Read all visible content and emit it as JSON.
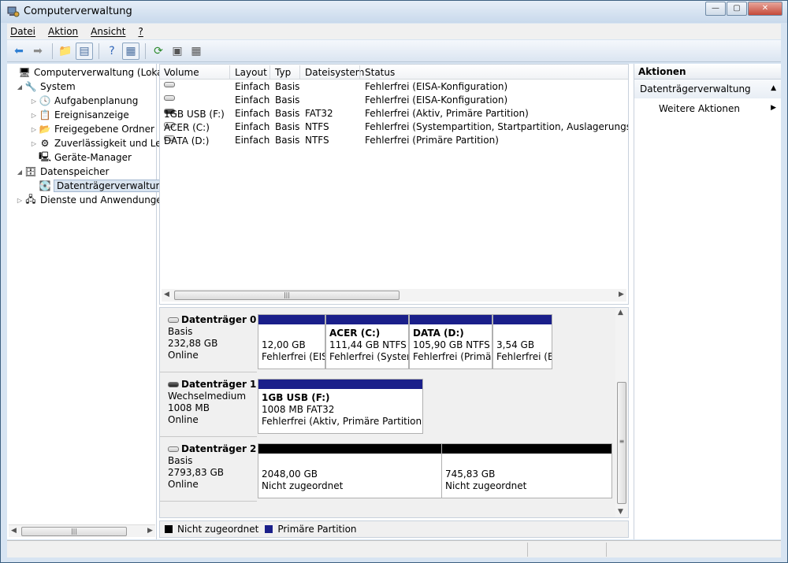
{
  "window": {
    "title": "Computerverwaltung",
    "buttons": {
      "minimize": "—",
      "maximize": "▢",
      "close": "✕"
    }
  },
  "menu": [
    {
      "label": "Datei"
    },
    {
      "label": "Aktion"
    },
    {
      "label": "Ansicht"
    },
    {
      "label": "?"
    }
  ],
  "toolbar": [
    {
      "icon": "back-arrow-icon",
      "glyph": "⬅",
      "color": "#2f7fd3"
    },
    {
      "icon": "forward-arrow-icon",
      "glyph": "➡",
      "color": "#8c8c8c"
    },
    {
      "icon": "up-folder-icon",
      "glyph": "📁",
      "color": "#c89b2d"
    },
    {
      "icon": "show-hide-console-tree-icon",
      "glyph": "▤",
      "color": "#4a6fa0"
    },
    {
      "icon": "help-icon",
      "glyph": "?",
      "color": "#2e64b8"
    },
    {
      "icon": "show-hide-action-pane-icon",
      "glyph": "▦",
      "color": "#4a6fa0"
    },
    {
      "icon": "refresh-icon",
      "glyph": "⟳",
      "color": "#2b8a2b"
    },
    {
      "icon": "properties-icon",
      "glyph": "▣",
      "color": "#555555"
    },
    {
      "icon": "export-list-icon",
      "glyph": "▦",
      "color": "#555555"
    }
  ],
  "tree": [
    {
      "label": "Computerverwaltung (Lokal)",
      "icon": "computer-management-icon",
      "glyph": "🖥",
      "indent": 0,
      "arrow": ""
    },
    {
      "label": "System",
      "icon": "system-tools-icon",
      "glyph": "🔧",
      "indent": 1,
      "arrow": "◢"
    },
    {
      "label": "Aufgabenplanung",
      "icon": "clock-icon",
      "glyph": "🕓",
      "indent": 2,
      "arrow": "▷"
    },
    {
      "label": "Ereignisanzeige",
      "icon": "event-viewer-icon",
      "glyph": "📋",
      "indent": 2,
      "arrow": "▷"
    },
    {
      "label": "Freigegebene Ordner",
      "icon": "shared-folder-icon",
      "glyph": "📂",
      "indent": 2,
      "arrow": "▷"
    },
    {
      "label": "Zuverlässigkeit und Leis",
      "icon": "performance-icon",
      "glyph": "⚙",
      "indent": 2,
      "arrow": "▷"
    },
    {
      "label": "Geräte-Manager",
      "icon": "device-manager-icon",
      "glyph": "🖳",
      "indent": 2,
      "arrow": ""
    },
    {
      "label": "Datenspeicher",
      "icon": "storage-icon",
      "glyph": "🗄",
      "indent": 1,
      "arrow": "◢"
    },
    {
      "label": "Datenträgerverwaltung",
      "icon": "disk-management-icon",
      "glyph": "💽",
      "indent": 2,
      "arrow": "",
      "selected": true
    },
    {
      "label": "Dienste und Anwendungen",
      "icon": "services-icon",
      "glyph": "🖧",
      "indent": 1,
      "arrow": "▷"
    }
  ],
  "volumes": {
    "columns": [
      "Volume",
      "Layout",
      "Typ",
      "Dateisystem",
      "Status"
    ],
    "rows": [
      {
        "volume": "",
        "layout": "Einfach",
        "typ": "Basis",
        "fs": "",
        "status": "Fehlerfrei (EISA-Konfiguration)",
        "usb": false
      },
      {
        "volume": "",
        "layout": "Einfach",
        "typ": "Basis",
        "fs": "",
        "status": "Fehlerfrei (EISA-Konfiguration)",
        "usb": false
      },
      {
        "volume": "1GB USB (F:)",
        "layout": "Einfach",
        "typ": "Basis",
        "fs": "FAT32",
        "status": "Fehlerfrei (Aktiv, Primäre Partition)",
        "usb": true
      },
      {
        "volume": "ACER (C:)",
        "layout": "Einfach",
        "typ": "Basis",
        "fs": "NTFS",
        "status": "Fehlerfrei (Systempartition, Startpartition, Auslagerungsdatei, Al",
        "usb": false
      },
      {
        "volume": "DATA (D:)",
        "layout": "Einfach",
        "typ": "Basis",
        "fs": "NTFS",
        "status": "Fehlerfrei (Primäre Partition)",
        "usb": false
      }
    ]
  },
  "disks": [
    {
      "name": "Datenträger 0",
      "type": "Basis",
      "size": "232,88 GB",
      "state": "Online",
      "usb": false,
      "partitions": [
        {
          "name": "",
          "size": "12,00 GB",
          "status": "Fehlerfrei (EIS",
          "bar": "primary"
        },
        {
          "name": "ACER  (C:)",
          "size": "111,44 GB NTFS",
          "status": "Fehlerfrei (Systen",
          "bar": "primary"
        },
        {
          "name": "DATA  (D:)",
          "size": "105,90 GB NTFS",
          "status": "Fehlerfrei (Primär",
          "bar": "primary"
        },
        {
          "name": "",
          "size": "3,54 GB",
          "status": "Fehlerfrei (E",
          "bar": "primary"
        }
      ]
    },
    {
      "name": "Datenträger 1",
      "type": "Wechselmedium",
      "size": "1008 MB",
      "state": "Online",
      "usb": true,
      "partitions": [
        {
          "name": "1GB USB  (F:)",
          "size": "1008 MB FAT32",
          "status": "Fehlerfrei (Aktiv, Primäre Partition)",
          "bar": "primary"
        }
      ]
    },
    {
      "name": "Datenträger 2",
      "type": "Basis",
      "size": "2793,83 GB",
      "state": "Online",
      "usb": false,
      "partitions": [
        {
          "name": "",
          "size": "2048,00 GB",
          "status": "Nicht zugeordnet",
          "bar": "unallocated"
        },
        {
          "name": "",
          "size": "745,83 GB",
          "status": "Nicht zugeordnet",
          "bar": "unallocated"
        }
      ]
    }
  ],
  "legend": [
    {
      "label": "Nicht zugeordnet",
      "color": "#000000"
    },
    {
      "label": "Primäre Partition",
      "color": "#1a1f8a"
    }
  ],
  "actions": {
    "title": "Aktionen",
    "section": "Datenträgerverwaltung",
    "items": [
      {
        "label": "Weitere Aktionen"
      }
    ]
  },
  "colors": {
    "primary": "#1a1f8a",
    "unallocated": "#000000"
  }
}
